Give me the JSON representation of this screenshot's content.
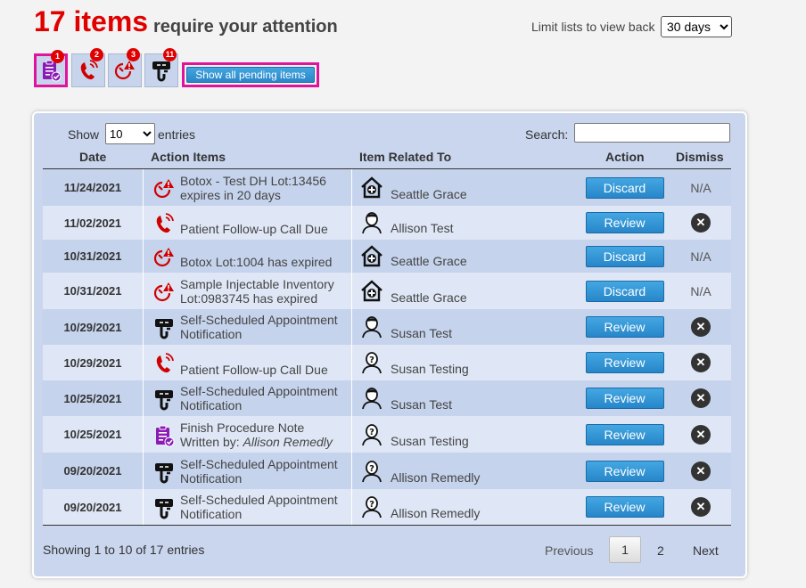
{
  "header": {
    "count_text": "17 items",
    "rest_text": "require your attention",
    "limit_label": "Limit lists to view back",
    "limit_value": "30 days"
  },
  "filters": [
    {
      "icon": "procedure-note-icon",
      "badge": "1",
      "active": true
    },
    {
      "icon": "phone-call-icon",
      "badge": "2",
      "active": false
    },
    {
      "icon": "inventory-alert-icon",
      "badge": "3",
      "active": false
    },
    {
      "icon": "self-schedule-icon",
      "badge": "11",
      "active": false
    }
  ],
  "show_all_label": "Show all pending items",
  "controls": {
    "show_label": "Show",
    "entries_value": "10",
    "entries_label": "entries",
    "search_label": "Search:"
  },
  "columns": [
    "Date",
    "Action Items",
    "Item Related To",
    "Action",
    "Dismiss"
  ],
  "rows": [
    {
      "date": "11/24/2021",
      "item_icon": "inventory-alert-icon",
      "item_line1": "Botox - Test DH Lot:13456",
      "item_line2": "expires in 20 days",
      "item_em": "",
      "rel_icon": "clinic-icon",
      "related": "Seattle Grace",
      "action": "Discard",
      "dismiss": "N/A"
    },
    {
      "date": "11/02/2021",
      "item_icon": "phone-call-icon",
      "item_line1": "",
      "item_line2": "Patient Follow-up Call Due",
      "item_em": "",
      "rel_icon": "person-icon",
      "related": "Allison Test",
      "action": "Review",
      "dismiss": "x"
    },
    {
      "date": "10/31/2021",
      "item_icon": "inventory-alert-icon",
      "item_line1": "",
      "item_line2": "Botox Lot:1004 has expired",
      "item_em": "",
      "rel_icon": "clinic-icon",
      "related": "Seattle Grace",
      "action": "Discard",
      "dismiss": "N/A"
    },
    {
      "date": "10/31/2021",
      "item_icon": "inventory-alert-icon",
      "item_line1": "Sample Injectable Inventory",
      "item_line2": "Lot:0983745 has expired",
      "item_em": "",
      "rel_icon": "clinic-icon",
      "related": "Seattle Grace",
      "action": "Discard",
      "dismiss": "N/A"
    },
    {
      "date": "10/29/2021",
      "item_icon": "self-schedule-icon",
      "item_line1": "Self-Scheduled Appointment",
      "item_line2": "Notification",
      "item_em": "",
      "rel_icon": "person-icon",
      "related": "Susan Test",
      "action": "Review",
      "dismiss": "x"
    },
    {
      "date": "10/29/2021",
      "item_icon": "phone-call-icon",
      "item_line1": "",
      "item_line2": "Patient Follow-up Call Due",
      "item_em": "",
      "rel_icon": "unknown-person-icon",
      "related": "Susan Testing",
      "action": "Review",
      "dismiss": "x"
    },
    {
      "date": "10/25/2021",
      "item_icon": "self-schedule-icon",
      "item_line1": "Self-Scheduled Appointment",
      "item_line2": "Notification",
      "item_em": "",
      "rel_icon": "person-icon",
      "related": "Susan Test",
      "action": "Review",
      "dismiss": "x"
    },
    {
      "date": "10/25/2021",
      "item_icon": "procedure-note-icon",
      "item_line1": "Finish Procedure Note",
      "item_line2": "Written by: ",
      "item_em": "Allison Remedly",
      "rel_icon": "unknown-person-icon",
      "related": "Susan Testing",
      "action": "Review",
      "dismiss": "x"
    },
    {
      "date": "09/20/2021",
      "item_icon": "self-schedule-icon",
      "item_line1": "Self-Scheduled Appointment",
      "item_line2": "Notification",
      "item_em": "",
      "rel_icon": "unknown-person-icon",
      "related": "Allison Remedly",
      "action": "Review",
      "dismiss": "x"
    },
    {
      "date": "09/20/2021",
      "item_icon": "self-schedule-icon",
      "item_line1": "Self-Scheduled Appointment",
      "item_line2": "Notification",
      "item_em": "",
      "rel_icon": "unknown-person-icon",
      "related": "Allison Remedly",
      "action": "Review",
      "dismiss": "x"
    }
  ],
  "footer": {
    "info": "Showing 1 to 10 of 17 entries",
    "previous": "Previous",
    "pages": [
      "1",
      "2"
    ],
    "next": "Next"
  },
  "colors": {
    "accent_red": "#e00000",
    "highlight_pink": "#e0149b",
    "button_blue": "#2a86c8",
    "note_purple": "#8a1bb5"
  }
}
